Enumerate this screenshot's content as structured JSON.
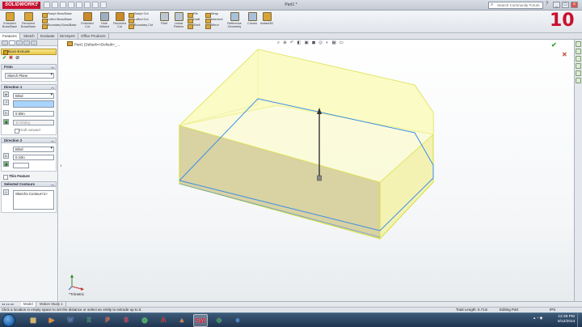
{
  "window": {
    "brand": "SOLIDWORKS",
    "doc_title": "Part1 *",
    "search_placeholder": "Search Community Forum",
    "help": "?",
    "controls": [
      "_",
      "□",
      "×"
    ],
    "step_number": "10"
  },
  "ribbon": {
    "buttons": [
      {
        "label": "Extruded Boss/Base",
        "color": "#d9a437"
      },
      {
        "label": "Revolved Boss/Base",
        "color": "#d9a437"
      },
      {
        "label": "Extruded Cut",
        "color": "#c98a2a"
      },
      {
        "label": "Hole Wizard",
        "color": "#9ab0c8"
      },
      {
        "label": "Revolved Cut",
        "color": "#c98a2a"
      },
      {
        "label": "Fillet",
        "color": "#b9c7d6"
      },
      {
        "label": "Linear Pattern",
        "color": "#b9c7d6"
      },
      {
        "label": "Reference Geometry",
        "color": "#a8c0dc"
      },
      {
        "label": "Curves",
        "color": "#a8c0dc"
      },
      {
        "label": "Instant3D",
        "color": "#d9a437"
      }
    ],
    "small": [
      {
        "label": "Swept Boss/Base"
      },
      {
        "label": "Lofted Boss/Base"
      },
      {
        "label": "Boundary Boss/Base"
      },
      {
        "label": "Swept Cut"
      },
      {
        "label": "Lofted Cut"
      },
      {
        "label": "Boundary Cut"
      },
      {
        "label": "Rib"
      },
      {
        "label": "Draft"
      },
      {
        "label": "Shell"
      },
      {
        "label": "Wrap"
      },
      {
        "label": "Intersect"
      },
      {
        "label": "Mirror"
      }
    ]
  },
  "command_tabs": [
    "Features",
    "Sketch",
    "Evaluate",
    "DimXpert",
    "Office Products"
  ],
  "property_manager": {
    "title": "Boss-Extrude",
    "actions": [
      "✔",
      "✖",
      "⊘"
    ],
    "from": {
      "header": "From",
      "value": "Sketch Plane"
    },
    "direction1": {
      "header": "Direction 1",
      "end_condition": "Blind",
      "depth": "0.50in",
      "draft_angle": "10.00deg",
      "draft_outward": "Draft outward"
    },
    "direction2": {
      "header": "Direction 2",
      "end_condition": "Blind",
      "depth": "0.10in"
    },
    "thin_feature": "Thin Feature",
    "selected_contours": {
      "header": "Selected Contours",
      "item": "Sketch1-Contour<1>"
    }
  },
  "graphics": {
    "tree_label": "Part1 (Default<<Default>_...",
    "view_label": "*Trimetric",
    "hud_icons": [
      "zoom-fit",
      "zoom-area",
      "previous-view",
      "section-view",
      "view-orientation",
      "display-style",
      "hide-show",
      "edit-appearance",
      "apply-scene",
      "view-settings"
    ]
  },
  "model_tabs": {
    "nav": "◂◂ ◂ ▸ ▸▸",
    "tabs": [
      "Model",
      "Motion Study 1"
    ]
  },
  "status": {
    "message": "Click a location in empty space to set the distance or select an entity to extrude up to it.",
    "total_length": "Total Length: 6.71in",
    "mode": "Editing Part",
    "units": "IPS"
  },
  "taskbar": {
    "apps": [
      {
        "name": "explorer",
        "glyph": "▤",
        "color": "#e0b44a"
      },
      {
        "name": "media-player",
        "glyph": "▶",
        "color": "#f08a24"
      },
      {
        "name": "word",
        "glyph": "W",
        "color": "#2b5797"
      },
      {
        "name": "excel",
        "glyph": "X",
        "color": "#1e7145"
      },
      {
        "name": "powerpoint",
        "glyph": "P",
        "color": "#d24726"
      },
      {
        "name": "solidworks-launcher",
        "glyph": "S",
        "color": "#c8102e"
      },
      {
        "name": "chrome",
        "glyph": "◉",
        "color": "#3aa757"
      },
      {
        "name": "acrobat",
        "glyph": "A",
        "color": "#b30b00"
      },
      {
        "name": "matlab",
        "glyph": "▲",
        "color": "#e07b39"
      },
      {
        "name": "solidworks",
        "glyph": "SW",
        "color": "#c8102e"
      },
      {
        "name": "media-center",
        "glyph": "◈",
        "color": "#2e8b57"
      },
      {
        "name": "internet-explorer",
        "glyph": "e",
        "color": "#1f7ad6"
      }
    ],
    "time": "12:39 PM",
    "date": "8/12/2014"
  },
  "colors": {
    "part_fill": "#f6f6a8",
    "part_edge": "#d6df3a",
    "contour": "#3a8ee6",
    "accent": "#c8102e"
  }
}
